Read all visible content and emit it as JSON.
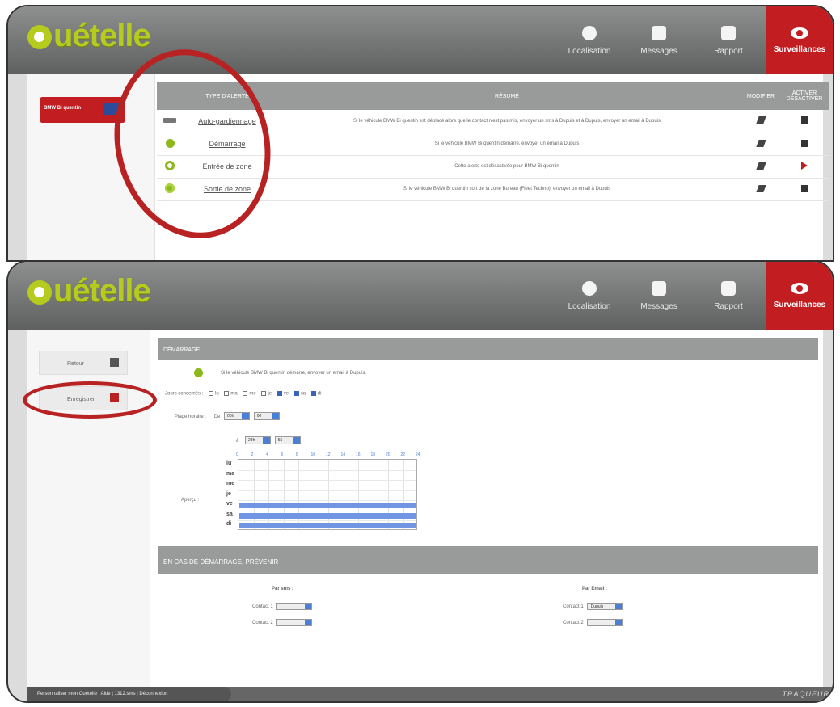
{
  "brand": {
    "logo_text": "uételle"
  },
  "nav": [
    {
      "label": "Localisation",
      "icon": "globe-icon"
    },
    {
      "label": "Messages",
      "icon": "envelope-icon"
    },
    {
      "label": "Rapport",
      "icon": "document-icon"
    },
    {
      "label": "Surveillances",
      "icon": "eye-icon",
      "active": true
    }
  ],
  "screen1": {
    "vehicle": "BMW Bi quentin",
    "headers": {
      "type": "TYPE D'ALERTE",
      "summary": "RÉSUMÉ",
      "modify": "MODIFIER",
      "toggle": "ACTIVER DÉSACTIVER"
    },
    "alerts": [
      {
        "type": "Auto-gardiennage",
        "summary": "Si le véhicule BMW Bi quentin est déplacé alors que le contact n'est pas mis, envoyer un sms à Dupuis et à Dupuis, envoyer un email à Dupuis",
        "icon": "key-icon"
      },
      {
        "type": "Démarrage",
        "summary": "Si le véhicule BMW Bi quentin démarre, envoyer un email à Dupuis",
        "icon": "start-icon"
      },
      {
        "type": "Entrée de zone",
        "summary": "Cette alerte est désactivée pour BMW Bi quentin",
        "icon": "zone-entry-icon"
      },
      {
        "type": "Sortie de zone",
        "summary": "Si le véhicule BMW Bi quentin sort de la zone Bureau (Fleet Techno), envoyer un email à Dupuis",
        "icon": "zone-exit-icon"
      }
    ]
  },
  "screen2": {
    "back_label": "Retour",
    "save_label": "Enregistrer",
    "section_title": "DÉMARRAGE",
    "description": "Si le véhicule BMW Bi quentin démarre, envoyer un email à Dupuis.",
    "days_label": "Jours concernés :",
    "days": [
      {
        "label": "lu",
        "checked": false
      },
      {
        "label": "ma",
        "checked": false
      },
      {
        "label": "me",
        "checked": false
      },
      {
        "label": "je",
        "checked": false
      },
      {
        "label": "ve",
        "checked": true
      },
      {
        "label": "sa",
        "checked": true
      },
      {
        "label": "di",
        "checked": true
      }
    ],
    "time_label": "Plage horaire :",
    "from_label": "De",
    "from_hour": "00h",
    "from_min": "00",
    "to_label": "à",
    "to_hour": "23h",
    "to_min": "55",
    "preview_label": "Aperçu :",
    "hours": [
      "0",
      "2",
      "4",
      "6",
      "8",
      "10",
      "12",
      "14",
      "16",
      "18",
      "20",
      "22",
      "24"
    ],
    "grid_days": [
      "lu",
      "ma",
      "me",
      "je",
      "ve",
      "sa",
      "di"
    ],
    "notify_title": "EN CAS DE DÉMARRAGE, PRÉVENIR :",
    "sms_title": "Par sms :",
    "email_title": "Par Email :",
    "contact1": "Contact 1",
    "contact2": "Contact 2",
    "email_contact1_value": "Dupuis"
  },
  "footer": {
    "links": "Personnaliser mon Ouételle | Aide | 1312.sms | Déconnexion",
    "brand": "TRAQUEUR"
  }
}
